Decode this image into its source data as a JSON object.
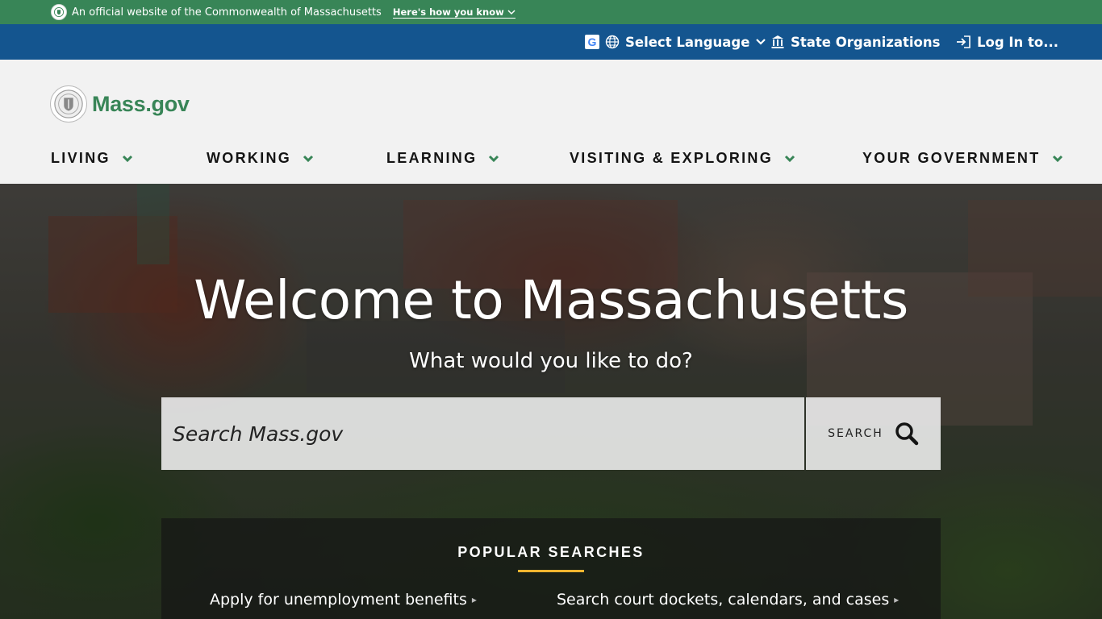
{
  "official_banner": {
    "text": "An official website of the Commonwealth of Massachusetts",
    "how_link": "Here's how you know"
  },
  "utility": {
    "language": "Select Language",
    "state_orgs": "State Organizations",
    "login": "Log In to..."
  },
  "header": {
    "brand": "Mass.gov",
    "nav": [
      {
        "label": "LIVING"
      },
      {
        "label": "WORKING"
      },
      {
        "label": "LEARNING"
      },
      {
        "label": "VISITING & EXPLORING"
      },
      {
        "label": "YOUR GOVERNMENT"
      }
    ]
  },
  "hero": {
    "title": "Welcome to Massachusetts",
    "subtitle": "What would you like to do?"
  },
  "search": {
    "placeholder": "Search Mass.gov",
    "button_label": "SEARCH"
  },
  "popular": {
    "title": "POPULAR SEARCHES",
    "links": [
      {
        "label": "Apply for unemployment benefits"
      },
      {
        "label": "Search court dockets, calendars, and cases"
      }
    ]
  },
  "colors": {
    "green": "#388557",
    "blue": "#14558f",
    "gold": "#f1b42f"
  }
}
